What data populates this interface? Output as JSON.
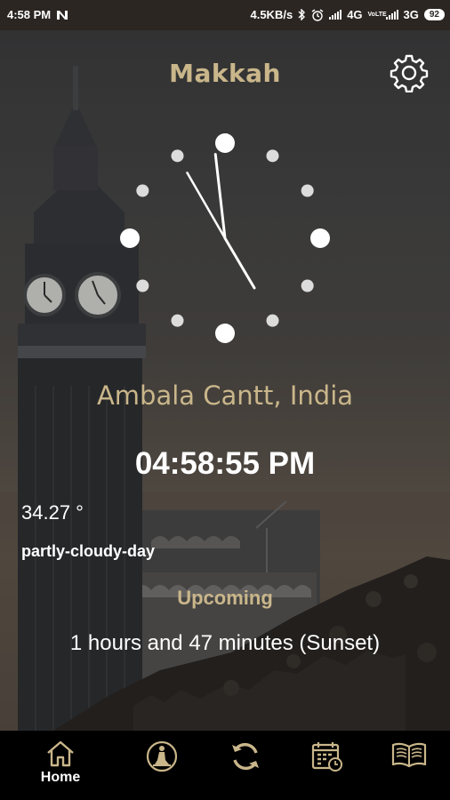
{
  "status_bar": {
    "time": "4:58 PM",
    "network_speed": "4.5KB/s",
    "mobile_1": "4G",
    "mobile_2": "3G",
    "volte": "VoLTE",
    "battery": "92"
  },
  "header": {
    "city": "Makkah",
    "settings_icon": "gear-icon"
  },
  "analog_clock": {
    "hours": 4,
    "minutes": 58,
    "seconds": 55
  },
  "location": "Ambala Cantt, India",
  "current_time": "04:58:55 PM",
  "weather": {
    "temperature": "34.27 °",
    "condition": "partly-cloudy-day"
  },
  "upcoming": {
    "label": "Upcoming",
    "value": "1 hours and 47 minutes (Sunset)"
  },
  "bottom_nav": {
    "items": [
      {
        "icon": "home-icon",
        "label": "Home",
        "active": true
      },
      {
        "icon": "prayer-icon",
        "label": ""
      },
      {
        "icon": "refresh-icon",
        "label": ""
      },
      {
        "icon": "calendar-icon",
        "label": ""
      },
      {
        "icon": "quran-book-icon",
        "label": ""
      }
    ]
  },
  "colors": {
    "accent": "#c9b68a",
    "text": "#ffffff",
    "nav_bg": "#000000",
    "status_bg": "#2b2622"
  }
}
